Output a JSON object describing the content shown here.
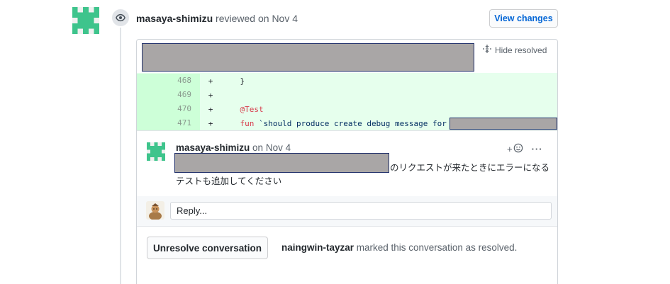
{
  "review": {
    "author": "masaya-shimizu",
    "action": " reviewed on Nov 4",
    "view_changes": "View changes"
  },
  "thread": {
    "hide_resolved": "Hide resolved"
  },
  "diff": {
    "lines": [
      {
        "num": "468",
        "sign": "+",
        "code": "    }"
      },
      {
        "num": "469",
        "sign": "+",
        "code": ""
      },
      {
        "num": "470",
        "sign": "+",
        "code_annotation": "@Test"
      },
      {
        "num": "471",
        "sign": "+",
        "code_keyword": "fun",
        "code_string": " `should produce create debug message for "
      }
    ]
  },
  "comment": {
    "author": "masaya-shimizu",
    "date": " on Nov 4",
    "body_line1_suffix": "のリクエストが来たときにエラーになる",
    "body_line2": "テストも追加してください",
    "add_reaction": "+",
    "more": "···"
  },
  "reply": {
    "placeholder": "Reply..."
  },
  "resolution": {
    "button": "Unresolve conversation",
    "resolver": "naingwin-tayzar",
    "message": " marked this conversation as resolved."
  },
  "colors": {
    "identicon": "#3ec48c",
    "link": "#0366d6",
    "diff_bg": "#e6ffed",
    "diff_num_bg": "#cdffd8",
    "redaction": "#a9a6a6"
  }
}
